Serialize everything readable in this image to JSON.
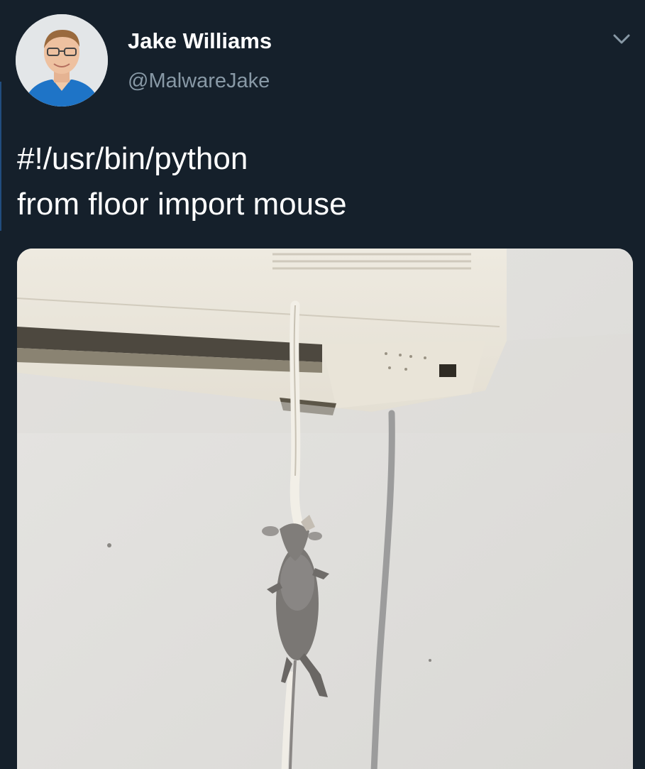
{
  "tweet": {
    "author_name": "Jake Williams",
    "author_handle": "@MalwareJake",
    "text_lines": [
      "#!/usr/bin/python",
      "from floor import mouse"
    ]
  },
  "icons": {
    "menu": "chevron-down-icon",
    "avatar": "profile-photo"
  },
  "colors": {
    "background": "#15202b",
    "name_text": "#ffffff",
    "handle_text": "#8899a6"
  }
}
